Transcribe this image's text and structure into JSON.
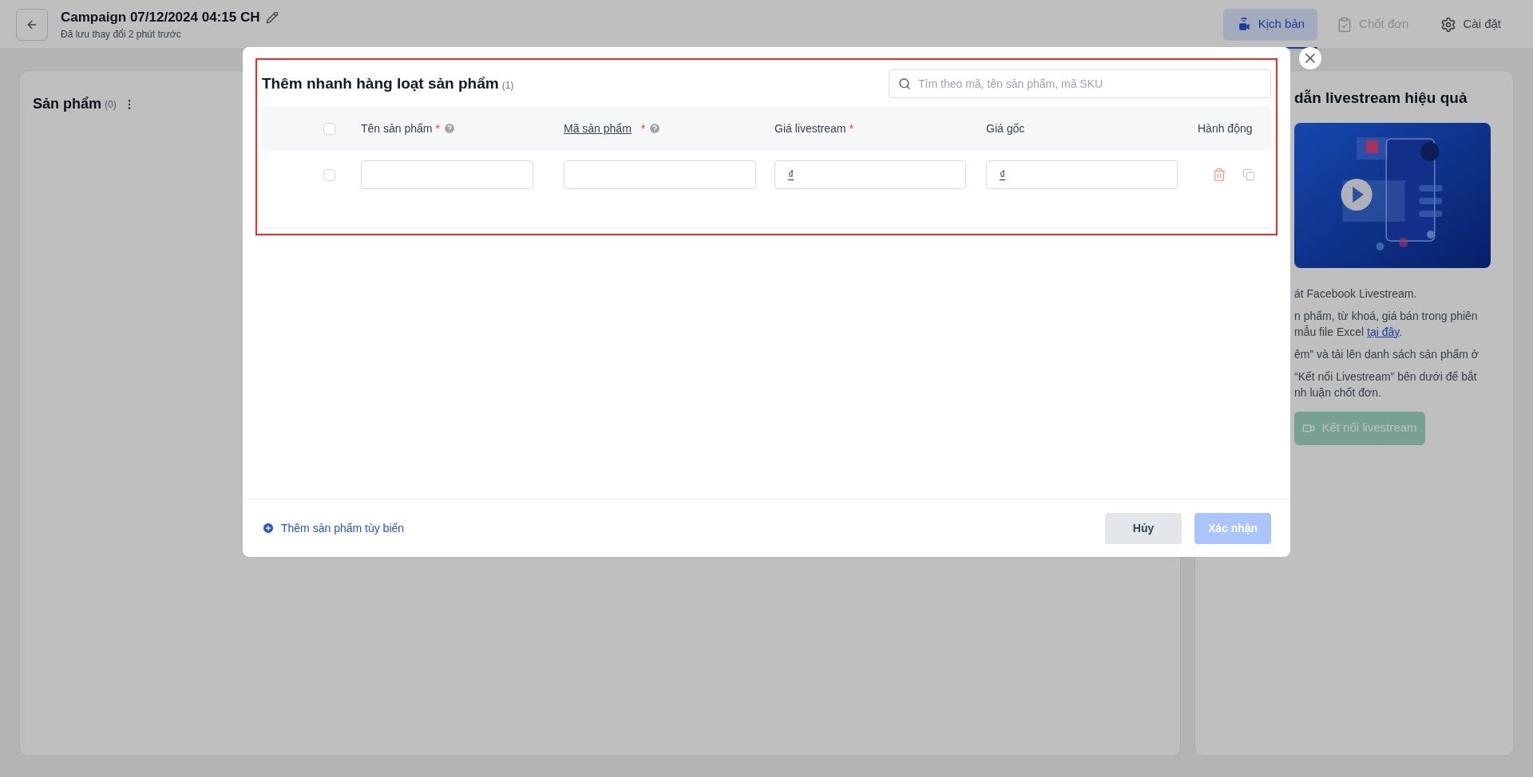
{
  "header": {
    "title": "Campaign 07/12/2024 04:15 CH",
    "subtitle": "Đã lưu thay đổi 2 phút trước"
  },
  "tabs": [
    {
      "label": "Kịch bản",
      "kind": "script",
      "selected": true,
      "disabled": false
    },
    {
      "label": "Chốt đơn",
      "kind": "orders",
      "selected": false,
      "disabled": true
    },
    {
      "label": "Cài đặt",
      "kind": "settings",
      "selected": false,
      "disabled": false
    }
  ],
  "products_panel": {
    "title": "Sản phẩm",
    "count": "(0)"
  },
  "guide_panel": {
    "title": "dẫn livestream hiệu quả",
    "paragraphs": [
      {
        "lines": [
          "át Facebook Livestream."
        ]
      },
      {
        "lines": [
          "n phẩm, từ khoá, giá bán trong phiên"
        ],
        "link": {
          "before": "mẫu file Excel ",
          "text": "tại đây",
          "after": "."
        }
      },
      {
        "lines": [
          "êm” và tải lên danh sách sản phẩm ở"
        ]
      },
      {
        "lines": [
          "“Kết nối Livestream” bên dưới để bắt",
          "nh luận chốt đơn."
        ]
      }
    ],
    "button": {
      "label": "Kết nối livestream",
      "disabled": true
    }
  },
  "modal": {
    "title": "Thêm nhanh hàng loạt sản phẩm",
    "count": "(1)",
    "search": {
      "placeholder": "Tìm theo mã, tên sản phẩm, mã SKU"
    },
    "header_checkbox": {
      "checked": false
    },
    "columns": [
      {
        "label": "Tên sản phẩm",
        "required_mark": "*",
        "help": true,
        "underlined": false
      },
      {
        "label": "Mã sản phẩm",
        "required_mark": "*",
        "help": true,
        "underlined": true
      },
      {
        "label": "Giá livestream",
        "required_mark": "*",
        "help": false,
        "underlined": false
      },
      {
        "label": "Giá gốc",
        "help": false,
        "underlined": false
      },
      {
        "label": "Hành động",
        "help": false,
        "underlined": false
      }
    ],
    "rows": [
      {
        "checked": false,
        "fields": [
          {
            "kind": "text"
          },
          {
            "kind": "text"
          },
          {
            "kind": "price",
            "prefix": "₫"
          },
          {
            "kind": "price",
            "prefix": "₫"
          }
        ]
      }
    ],
    "add_link": "Thêm sản phẩm tùy biến",
    "buttons": [
      {
        "label": "Hủy",
        "kind": "secondary",
        "disabled": false
      },
      {
        "label": "Xác nhận",
        "kind": "primary",
        "disabled": true
      }
    ]
  }
}
